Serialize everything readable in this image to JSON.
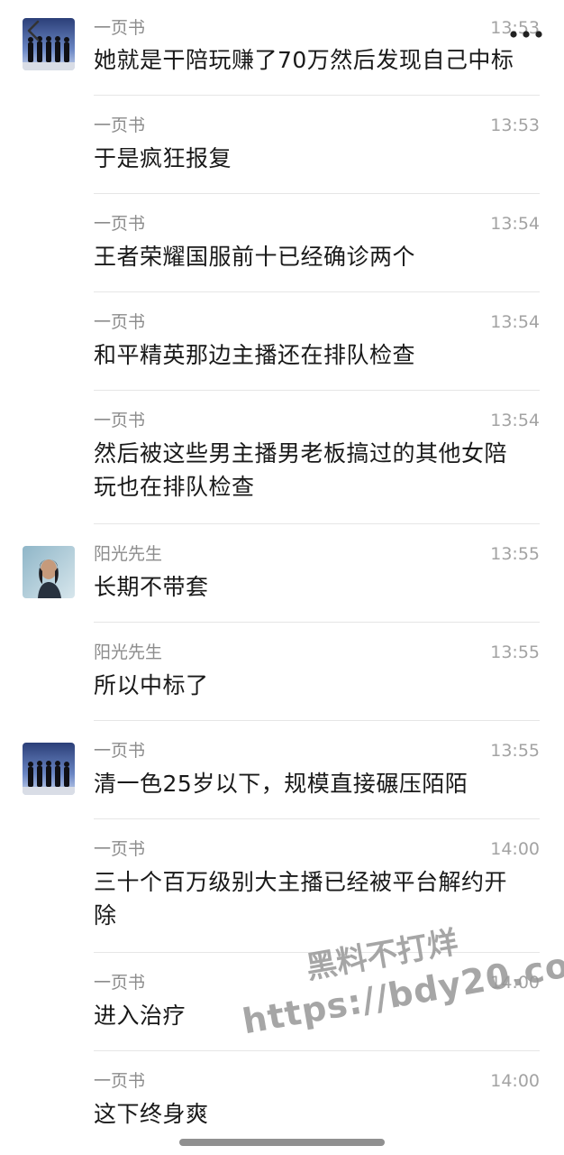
{
  "header": {
    "back_icon": "chevron-left-icon",
    "more_icon": "more-dots-icon"
  },
  "messages": [
    {
      "sender": "一页书",
      "time": "13:53",
      "text": "她就是干陪玩赚了70万然后发现自己中标",
      "avatar": "group-silhouette"
    },
    {
      "sender": "一页书",
      "time": "13:53",
      "text": "于是疯狂报复"
    },
    {
      "sender": "一页书",
      "time": "13:54",
      "text": "王者荣耀国服前十已经确诊两个"
    },
    {
      "sender": "一页书",
      "time": "13:54",
      "text": "和平精英那边主播还在排队检查"
    },
    {
      "sender": "一页书",
      "time": "13:54",
      "text": "然后被这些男主播男老板搞过的其他女陪玩也在排队检查"
    },
    {
      "sender": "阳光先生",
      "time": "13:55",
      "text": "长期不带套",
      "avatar": "man-portrait"
    },
    {
      "sender": "阳光先生",
      "time": "13:55",
      "text": "所以中标了"
    },
    {
      "sender": "一页书",
      "time": "13:55",
      "text": "清一色25岁以下，规模直接碾压陌陌",
      "avatar": "group-silhouette"
    },
    {
      "sender": "一页书",
      "time": "14:00",
      "text": "三十个百万级别大主播已经被平台解约开除"
    },
    {
      "sender": "一页书",
      "time": "14:00",
      "text": "进入治疗"
    },
    {
      "sender": "一页书",
      "time": "14:00",
      "text": "这下终身爽"
    }
  ],
  "watermark": {
    "line1": "黑料不打烊",
    "line2": "https://bdy20.co"
  },
  "colors": {
    "background": "#ffffff",
    "text": "#191919",
    "name": "#8c8c8c",
    "time": "#a3a3a3",
    "divider": "#e6e6e6"
  }
}
